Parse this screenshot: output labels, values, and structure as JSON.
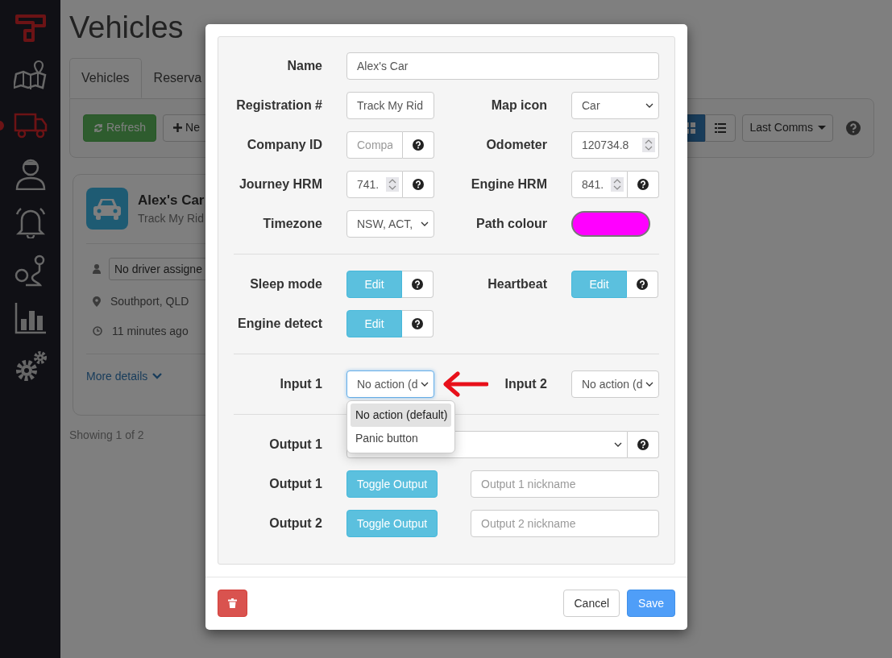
{
  "sidebar": {
    "items": [
      {
        "kind": "map",
        "selected": false
      },
      {
        "kind": "truck",
        "selected": true
      },
      {
        "kind": "user",
        "selected": false
      },
      {
        "kind": "bell",
        "selected": false
      },
      {
        "kind": "route",
        "selected": false
      },
      {
        "kind": "chart",
        "selected": false
      },
      {
        "kind": "gears",
        "selected": false
      }
    ]
  },
  "page": {
    "title": "Vehicles",
    "tabs": [
      {
        "label": "Vehicles",
        "selected": true
      },
      {
        "label": "Reserva",
        "selected": false
      }
    ],
    "toolbar": {
      "refresh": "Refresh",
      "new": "Ne",
      "sort": "Last Comms",
      "view_modes": [
        {
          "kind": "grid",
          "selected": true
        },
        {
          "kind": "list",
          "selected": false
        }
      ]
    },
    "vehicle_card": {
      "name": "Alex's Car",
      "subtitle": "Track My Rid",
      "driver": "No driver assigne",
      "location": "Southport, QLD",
      "last_seen": "11 minutes ago",
      "more": "More details"
    },
    "footer": "Showing 1 of 2"
  },
  "modal": {
    "sections": [
      {
        "rows": [
          {
            "fields": [
              {
                "label": "Name",
                "kind": "text-wide",
                "value": "Alex's Car"
              }
            ]
          },
          {
            "fields": [
              {
                "label": "Registration #",
                "kind": "text",
                "value": "Track My Rid"
              },
              {
                "label": "Map icon",
                "kind": "select",
                "value": "Car"
              }
            ]
          },
          {
            "fields": [
              {
                "label": "Company ID",
                "kind": "text",
                "placeholder": "Compa",
                "help": true
              },
              {
                "label": "Odometer",
                "kind": "number",
                "value": "120734.8"
              }
            ]
          },
          {
            "fields": [
              {
                "label": "Journey HRM",
                "kind": "number",
                "value": "741.",
                "help": true
              },
              {
                "label": "Engine HRM",
                "kind": "number",
                "value": "841.",
                "help": true
              }
            ]
          },
          {
            "fields": [
              {
                "label": "Timezone",
                "kind": "select",
                "value": "NSW, ACT,"
              },
              {
                "label": "Path colour",
                "kind": "color",
                "color": "#ff00ff"
              }
            ]
          }
        ]
      },
      {
        "rows": [
          {
            "fields": [
              {
                "label": "Sleep mode",
                "kind": "button",
                "button": "Edit",
                "help": true
              },
              {
                "label": "Heartbeat",
                "kind": "button",
                "button": "Edit",
                "help": true
              }
            ]
          },
          {
            "fields": [
              {
                "label": "Engine detect",
                "kind": "button",
                "button": "Edit",
                "help": true
              }
            ]
          }
        ]
      },
      {
        "rows": [
          {
            "fields": [
              {
                "label": "Input 1",
                "kind": "select",
                "value": "No action (d",
                "focused": true,
                "menu": [
                  {
                    "label": "No action (default)",
                    "selected": true
                  },
                  {
                    "label": "Panic button",
                    "selected": false
                  }
                ]
              },
              {
                "label": "Input 2",
                "kind": "select",
                "value": "No action (d",
                "focused": false
              }
            ]
          }
        ]
      },
      {
        "rows": [
          {
            "fields": [
              {
                "label": "Output 1",
                "kind": "select-wide",
                "help": true
              }
            ]
          },
          {
            "fields": [
              {
                "label": "Output 1",
                "kind": "toggle",
                "button": "Toggle Output",
                "placeholder": "Output 1 nickname"
              }
            ]
          },
          {
            "fields": [
              {
                "label": "Output 2",
                "kind": "toggle",
                "button": "Toggle Output",
                "placeholder": "Output 2 nickname"
              }
            ]
          }
        ]
      }
    ],
    "footer": {
      "cancel": "Cancel",
      "save": "Save"
    }
  }
}
